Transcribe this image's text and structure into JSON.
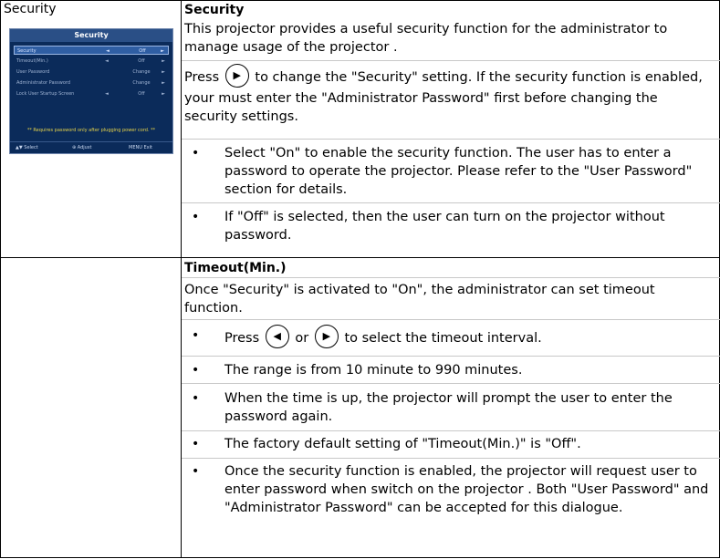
{
  "left_label": "Security",
  "menu": {
    "title": "Security",
    "rows": [
      {
        "label": "Security",
        "mid": "◄",
        "value": "Off",
        "arrow": "►"
      },
      {
        "label": "Timeout(Min.)",
        "mid": "◄",
        "value": "Off",
        "arrow": "►"
      },
      {
        "label": "User Password",
        "mid": "",
        "value": "Change",
        "arrow": "►"
      },
      {
        "label": "Administrator Password",
        "mid": "",
        "value": "Change",
        "arrow": "►"
      },
      {
        "label": "Lock User Startup Screen",
        "mid": "◄",
        "value": "Off",
        "arrow": "►"
      }
    ],
    "note": "** Requires password only after plugging power cord. **",
    "foot": {
      "select": "▲▼ Select",
      "adjust": "⊕ Adjust",
      "exit": "MENU Exit"
    }
  },
  "security": {
    "title": "Security",
    "intro": "This projector provides a useful security function for the administrator to manage usage of the projector .",
    "press_prefix": "Press",
    "press_icon": "▶",
    "press_rest": "to change the \"Security\" setting. If the security function is enabled, your must enter the \"Administrator Password\" first before changing the security settings.",
    "bullet": "•",
    "bullets": [
      "Select \"On\" to enable the security function. The user has to enter a password to operate the projector. Please refer to the \"User Password\" section for details.",
      "If \"Off\" is selected, then the user can turn on the projector without password."
    ]
  },
  "timeout": {
    "title": "Timeout(Min.)",
    "intro": "Once \"Security\" is activated to \"On\", the administrator can set timeout function.",
    "press_prefix": "Press",
    "left_icon": "◀",
    "or_text": "or",
    "right_icon": "▶",
    "press_rest": "to select the timeout interval.",
    "bullets": [
      "The range is from 10 minute to 990 minutes.",
      "When the time is up, the projector will prompt the user to enter the password again.",
      "The factory default setting of \"Timeout(Min.)\" is \"Off\".",
      "Once the security function is enabled, the projector will request user to enter password when switch on the projector . Both \"User Password\" and \"Administrator Password\" can be accepted for this dialogue."
    ]
  }
}
